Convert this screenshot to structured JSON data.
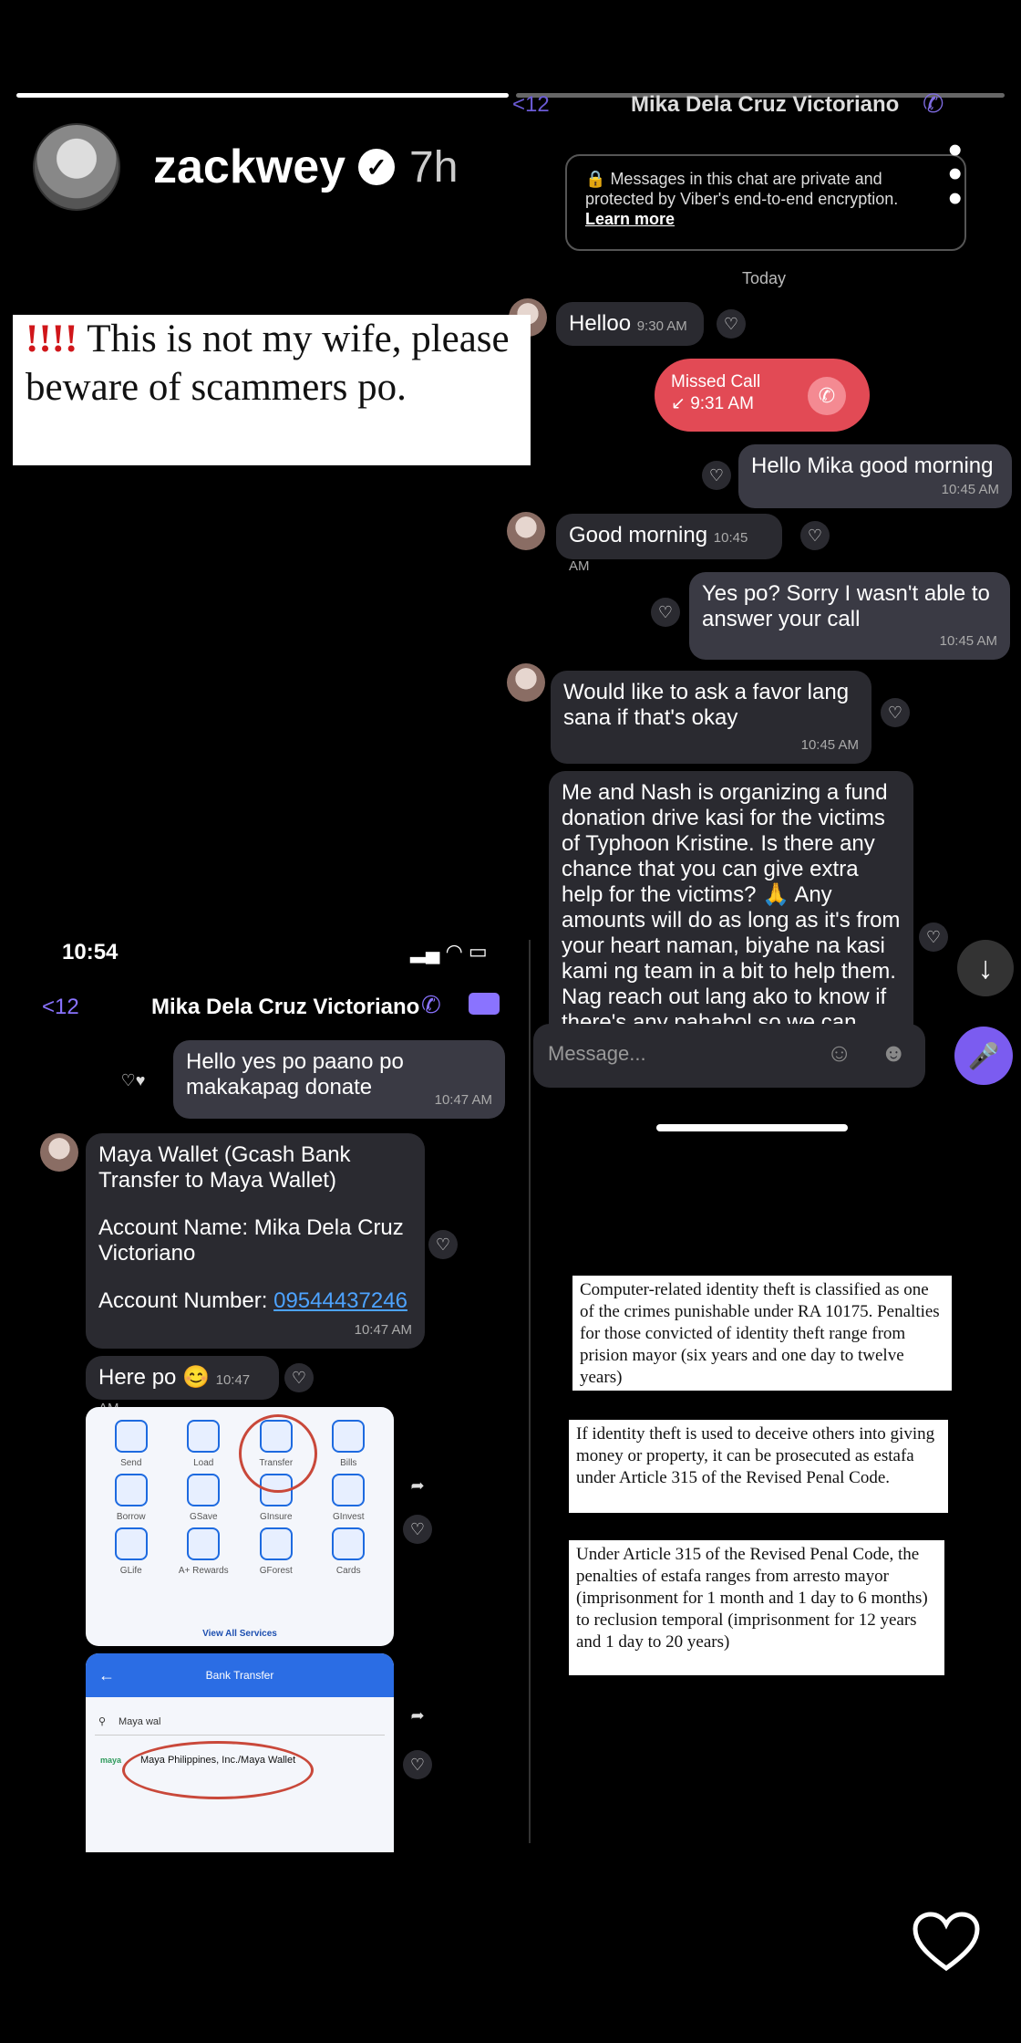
{
  "story": {
    "username": "zackwey",
    "time_ago": "7h",
    "warning_bangs": "!!!!",
    "warning_text": "This is not my wife, please beware of scammers po."
  },
  "chat_right": {
    "back": "12",
    "contact": "Mika Dela Cruz Victoriano",
    "encryption_text": "Messages in this chat are private and protected by Viber's end-to-end encryption.",
    "learn_more": "Learn more",
    "date_divider": "Today",
    "messages": [
      {
        "text": "Helloo",
        "time": "9:30 AM"
      },
      {
        "missed_title": "Missed Call",
        "time": "9:31 AM"
      },
      {
        "text": "Hello Mika good morning",
        "time": "10:45 AM"
      },
      {
        "text": "Good morning",
        "time": "10:45 AM"
      },
      {
        "text": "Yes po? Sorry I wasn't able to answer your call",
        "time": "10:45 AM"
      },
      {
        "text": "Would like to ask a favor lang sana if that's okay",
        "time": "10:45 AM"
      },
      {
        "text": "Me and Nash is organizing a fund donation drive kasi for the victims of Typhoon Kristine. Is there any chance that you can give extra help for the victims? 🙏 Any amounts will do as long as it's from your heart naman, biyahe na kasi kami ng team in a bit to help them. Nag reach out lang ako to know if there's any pahabol so we can give more help to the affected"
      }
    ],
    "input_placeholder": "Message..."
  },
  "chat_left": {
    "status_time": "10:54",
    "back": "12",
    "contact": "Mika Dela Cruz Victoriano",
    "messages": [
      {
        "text": "Hello yes po paano po makakapag donate",
        "time": "10:47 AM"
      },
      {
        "line1": "Maya Wallet (Gcash Bank Transfer to Maya Wallet)",
        "line2": "Account Name: Mika Dela Cruz Victoriano",
        "acct_label": "Account Number: ",
        "acct_number": "09544437246",
        "time": "10:47 AM"
      },
      {
        "text": "Here po 😊",
        "time": "10:47 AM"
      }
    ],
    "app_grid": [
      "Send",
      "Load",
      "Transfer",
      "Bills",
      "Borrow",
      "GSave",
      "GInsure",
      "GInvest",
      "GLife",
      "A+ Rewards",
      "GForest",
      "Cards"
    ],
    "view_all": "View All Services",
    "bank_transfer_title": "Bank Transfer",
    "search_value": "Maya wal",
    "result_tag": "maya",
    "result_text": "Maya Philippines, Inc./Maya Wallet"
  },
  "notices": [
    "Computer-related identity theft is classified as one of the crimes punishable under RA 10175. Penalties for those convicted of identity theft range from prision mayor (six years and one day to twelve years)",
    "If identity theft is used to deceive others into giving money or property, it can be prosecuted as estafa under Article 315 of the Revised Penal Code.",
    "Under Article 315 of the Revised Penal Code, the penalties of estafa ranges from arresto mayor (imprisonment for 1 month and 1 day to 6 months) to reclusion temporal (imprisonment for 12 years and 1 day to 20 years)"
  ],
  "colors": {
    "accent": "#7b5cf0",
    "missed_call": "#e24a55",
    "link": "#4da3ff"
  }
}
